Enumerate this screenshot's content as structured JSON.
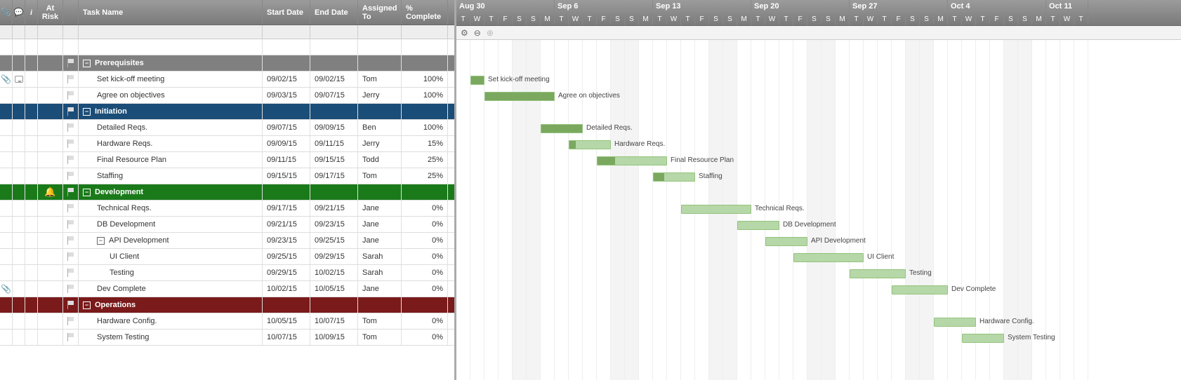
{
  "columns": {
    "attach_icon": "paperclip-icon",
    "comment_icon": "comment-icon",
    "info_label": "i",
    "risk_label": "At Risk",
    "task_label": "Task Name",
    "start_label": "Start Date",
    "end_label": "End Date",
    "assigned_label": "Assigned To",
    "pct_label": "% Complete"
  },
  "rows": [
    {
      "type": "blank"
    },
    {
      "type": "group",
      "variant": "prereq",
      "name": "Prerequisites"
    },
    {
      "type": "task",
      "indent": 1,
      "name": "Set kick-off meeting",
      "start": "09/02/15",
      "end": "09/02/15",
      "assn": "Tom",
      "pct": "100%",
      "barStart": 2,
      "barLen": 1,
      "barFill": 1.0,
      "attach": true,
      "comment": true
    },
    {
      "type": "task",
      "indent": 1,
      "name": "Agree on objectives",
      "start": "09/03/15",
      "end": "09/07/15",
      "assn": "Jerry",
      "pct": "100%",
      "barStart": 3,
      "barLen": 5,
      "barFill": 1.0
    },
    {
      "type": "group",
      "variant": "init",
      "name": "Initiation"
    },
    {
      "type": "task",
      "indent": 1,
      "name": "Detailed Reqs.",
      "start": "09/07/15",
      "end": "09/09/15",
      "assn": "Ben",
      "pct": "100%",
      "barStart": 7,
      "barLen": 3,
      "barFill": 1.0
    },
    {
      "type": "task",
      "indent": 1,
      "name": "Hardware Reqs.",
      "start": "09/09/15",
      "end": "09/11/15",
      "assn": "Jerry",
      "pct": "15%",
      "barStart": 9,
      "barLen": 3,
      "barFill": 0.15
    },
    {
      "type": "task",
      "indent": 1,
      "name": "Final Resource Plan",
      "start": "09/11/15",
      "end": "09/15/15",
      "assn": "Todd",
      "pct": "25%",
      "barStart": 11,
      "barLen": 5,
      "barFill": 0.25
    },
    {
      "type": "task",
      "indent": 1,
      "name": "Staffing",
      "start": "09/15/15",
      "end": "09/17/15",
      "assn": "Tom",
      "pct": "25%",
      "barStart": 15,
      "barLen": 3,
      "barFill": 0.25
    },
    {
      "type": "group",
      "variant": "dev",
      "name": "Development",
      "bell": true
    },
    {
      "type": "task",
      "indent": 1,
      "name": "Technical Reqs.",
      "start": "09/17/15",
      "end": "09/21/15",
      "assn": "Jane",
      "pct": "0%",
      "barStart": 17,
      "barLen": 5,
      "barFill": 0
    },
    {
      "type": "task",
      "indent": 1,
      "name": "DB Development",
      "start": "09/21/15",
      "end": "09/23/15",
      "assn": "Jane",
      "pct": "0%",
      "barStart": 21,
      "barLen": 3,
      "barFill": 0
    },
    {
      "type": "task",
      "indent": 1,
      "name": "API Development",
      "start": "09/23/15",
      "end": "09/25/15",
      "assn": "Jane",
      "pct": "0%",
      "barStart": 23,
      "barLen": 3,
      "barFill": 0,
      "subcollapse": true
    },
    {
      "type": "task",
      "indent": 2,
      "name": "UI Client",
      "start": "09/25/15",
      "end": "09/29/15",
      "assn": "Sarah",
      "pct": "0%",
      "barStart": 25,
      "barLen": 5,
      "barFill": 0
    },
    {
      "type": "task",
      "indent": 2,
      "name": "Testing",
      "start": "09/29/15",
      "end": "10/02/15",
      "assn": "Sarah",
      "pct": "0%",
      "barStart": 29,
      "barLen": 4,
      "barFill": 0
    },
    {
      "type": "task",
      "indent": 1,
      "name": "Dev Complete",
      "start": "10/02/15",
      "end": "10/05/15",
      "assn": "Jane",
      "pct": "0%",
      "barStart": 32,
      "barLen": 4,
      "barFill": 0,
      "attach": true
    },
    {
      "type": "group",
      "variant": "ops",
      "name": "Operations"
    },
    {
      "type": "task",
      "indent": 1,
      "name": "Hardware Config.",
      "start": "10/05/15",
      "end": "10/07/15",
      "assn": "Tom",
      "pct": "0%",
      "barStart": 35,
      "barLen": 3,
      "barFill": 0
    },
    {
      "type": "task",
      "indent": 1,
      "name": "System Testing",
      "start": "10/07/15",
      "end": "10/09/15",
      "assn": "Tom",
      "pct": "0%",
      "barStart": 37,
      "barLen": 3,
      "barFill": 0
    }
  ],
  "timeline": {
    "dayWidth": 20,
    "startOffset": 0,
    "months": [
      {
        "label": "Aug 30",
        "days": 7
      },
      {
        "label": "Sep 6",
        "days": 7
      },
      {
        "label": "Sep 13",
        "days": 7
      },
      {
        "label": "Sep 20",
        "days": 7
      },
      {
        "label": "Sep 27",
        "days": 7
      },
      {
        "label": "Oct 4",
        "days": 7
      },
      {
        "label": "Oct 11",
        "days": 3
      }
    ],
    "days": [
      "T",
      "W",
      "T",
      "F",
      "S",
      "S",
      "M",
      "T",
      "W",
      "T",
      "F",
      "S",
      "S",
      "M",
      "T",
      "W",
      "T",
      "F",
      "S",
      "S",
      "M",
      "T",
      "W",
      "T",
      "F",
      "S",
      "S",
      "M",
      "T",
      "W",
      "T",
      "F",
      "S",
      "S",
      "M",
      "T",
      "W",
      "T",
      "F",
      "S",
      "S",
      "M",
      "T",
      "W",
      "T"
    ],
    "weekend": [
      4,
      5,
      11,
      12,
      18,
      19,
      25,
      26,
      32,
      33,
      39,
      40
    ]
  },
  "toolbar": {
    "gear": "⚙",
    "zoomOut": "⊖",
    "zoomIn": "⊕"
  }
}
